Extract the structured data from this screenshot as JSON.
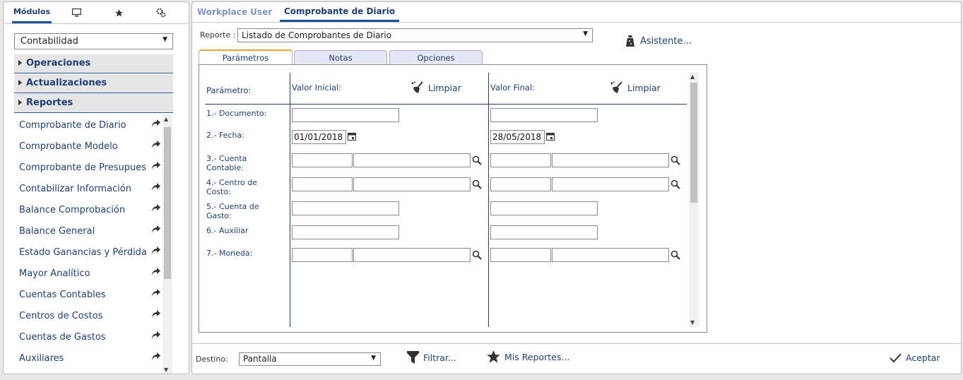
{
  "left": {
    "tabs": {
      "modulos": "Módulos"
    },
    "module_select": "Contabilidad",
    "sections": [
      "Operaciones",
      "Actualizaciones",
      "Reportes"
    ],
    "reports": [
      "Comprobante de Diario",
      "Comprobante Modelo",
      "Comprobante de Presupues",
      "Contabilizar Información",
      "Balance Comprobación",
      "Balance General",
      "Estado Ganancias y Pérdida",
      "Mayor Analítico",
      "Cuentas Contables",
      "Centros de Costos",
      "Cuentas de Gastos",
      "Auxiliares"
    ]
  },
  "main": {
    "tabs": [
      "Workplace User",
      "Comprobante de Diario"
    ],
    "reporte_label": "Reporte :",
    "reporte_value": "Listado de Comprobantes de Diario",
    "asistente": "Asistente...",
    "inner_tabs": [
      "Parámetros",
      "Notas",
      "Opciones"
    ],
    "params": {
      "col_parametro": "Parámetro:",
      "col_inicial": "Valor Inicial:",
      "col_final": "Valor Final:",
      "limpiar": "Limpiar",
      "rows": {
        "documento": "1.- Documento:",
        "fecha": "2.- Fecha:",
        "cuenta_1": "3.- Cuenta",
        "cuenta_2": "Contable:",
        "centro_1": "4.- Centro de",
        "centro_2": "Costo:",
        "gasto_1": "5.- Cuenta de",
        "gasto_2": "Gasto:",
        "auxiliar": "6.- Auxiliar",
        "moneda": "7.- Moneda:"
      },
      "fecha_inicial": "01/01/2018",
      "fecha_final": "28/05/2018"
    },
    "footer": {
      "destino_label": "Destino:",
      "destino_value": "Pantalla",
      "filtrar": "Filtrar...",
      "mis_reportes": "Mis Reportes...",
      "aceptar": "Aceptar"
    }
  },
  "colors": {
    "accent": "#1f4e98",
    "link": "#1f3f75",
    "tab_highlight": "#f0a030"
  },
  "icons": [
    "monitor-icon",
    "star-icon",
    "gear-icon",
    "share-arrow-icon",
    "broom-icon",
    "calendar-icon",
    "magnifier-icon",
    "wizard-icon",
    "filter-icon",
    "check-icon"
  ]
}
